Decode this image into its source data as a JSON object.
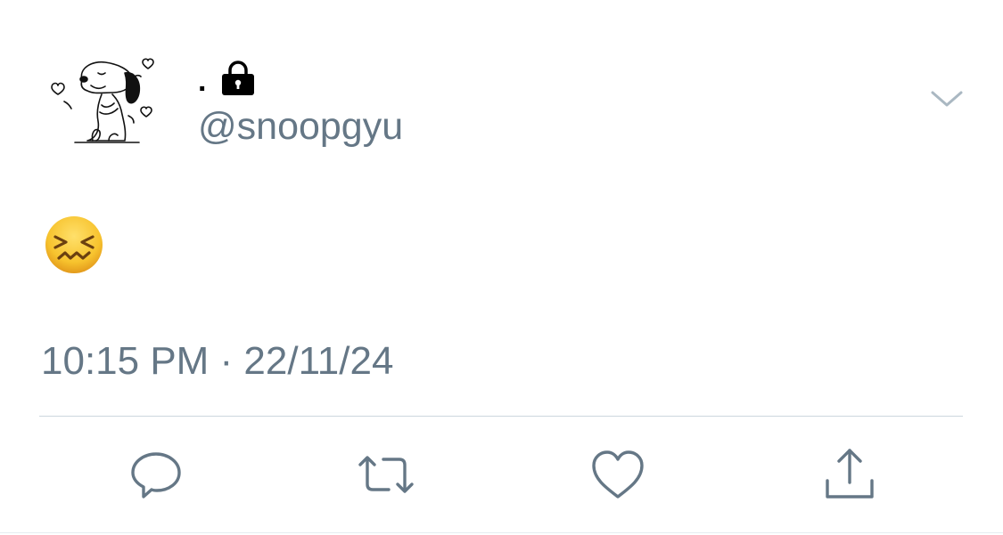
{
  "tweet": {
    "display_name": ".",
    "handle": "@snoopgyu",
    "timestamp": "10:15 PM · 22/11/24",
    "body_emoji": "confounded-face"
  },
  "icons": {
    "avatar": "snoopy-avatar",
    "lock": "lock-icon",
    "more": "chevron-down-icon",
    "reply": "reply-icon",
    "retweet": "retweet-icon",
    "like": "heart-icon",
    "share": "share-icon"
  },
  "colors": {
    "secondary_text": "#657786",
    "icon": "#657786",
    "divider": "#ccd6dd",
    "emoji_yellow": "#f7c32e"
  }
}
